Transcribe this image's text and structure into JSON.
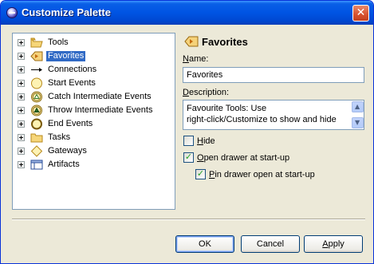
{
  "window": {
    "title": "Customize Palette",
    "close_symbol": "✕"
  },
  "tree": {
    "items": [
      {
        "label": "Tools",
        "icon": "folder-icon",
        "selected": false
      },
      {
        "label": "Favorites",
        "icon": "favorites-icon",
        "selected": true
      },
      {
        "label": "Connections",
        "icon": "connection-arrow-icon",
        "selected": false
      },
      {
        "label": "Start Events",
        "icon": "start-event-icon",
        "selected": false
      },
      {
        "label": "Catch Intermediate Events",
        "icon": "catch-event-icon",
        "selected": false
      },
      {
        "label": "Throw Intermediate Events",
        "icon": "throw-event-icon",
        "selected": false
      },
      {
        "label": "End Events",
        "icon": "end-event-icon",
        "selected": false
      },
      {
        "label": "Tasks",
        "icon": "task-folder-icon",
        "selected": false
      },
      {
        "label": "Gateways",
        "icon": "gateway-icon",
        "selected": false
      },
      {
        "label": "Artifacts",
        "icon": "artifact-icon",
        "selected": false
      }
    ]
  },
  "details": {
    "title": "Favorites",
    "name_label_first": "N",
    "name_label_rest": "ame:",
    "name_value": "Favorites",
    "description_label_first": "D",
    "description_label_rest": "escription:",
    "description_line1": "Favourite Tools: Use",
    "description_line2": "right-click/Customize to show and hide",
    "hide_label_first": "H",
    "hide_label_rest": "ide",
    "hide_checked": false,
    "open_drawer_label_first": "O",
    "open_drawer_label_rest": "pen drawer at start-up",
    "open_drawer_checked": true,
    "pin_drawer_label_first": "P",
    "pin_drawer_label_rest": "in drawer open at start-up",
    "pin_drawer_checked": true
  },
  "buttons": {
    "ok": "OK",
    "cancel": "Cancel",
    "apply_first": "A",
    "apply_rest": "pply"
  },
  "check_mark": "✓",
  "scroll_up": "▲",
  "scroll_down": "▼"
}
